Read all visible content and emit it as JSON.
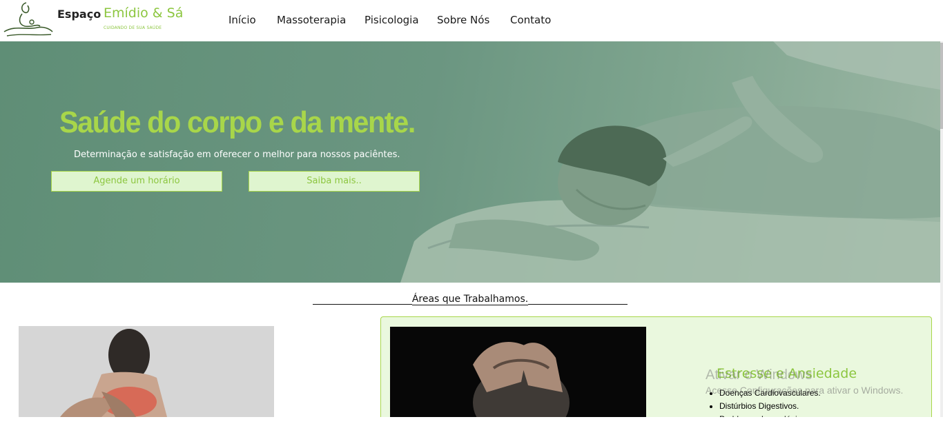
{
  "brand": {
    "name_part1": "Espaço",
    "name_part2": "Emídio & Sá",
    "tagline": "CUIDANDO DE SUA SAÚDE",
    "logo_icon": "massage-figure-icon"
  },
  "nav": {
    "items": [
      {
        "label": "Início"
      },
      {
        "label": "Massoterapia"
      },
      {
        "label": "Pisicologia"
      },
      {
        "label": "Sobre Nós"
      },
      {
        "label": "Contato"
      }
    ]
  },
  "hero": {
    "title": "Saúde do corpo e da mente.",
    "subtitle": "Determinação e satisfação em oferecer o melhor para nossos paciêntes.",
    "primary_button": "Agende um horário",
    "secondary_button": "Saiba mais.."
  },
  "areas": {
    "title": "Áreas que Trabalhamos."
  },
  "card": {
    "title": "Estresse e Ansiedade",
    "items": [
      "Doenças Cardiovasculares.",
      "Distúrbios Digestivos.",
      "Problemas Imunológicos."
    ]
  },
  "watermark": {
    "line1": "Ativar o Windows",
    "line2": "Acesse Configurações para ativar o Windows."
  },
  "colors": {
    "accent": "#8cc63f",
    "hero_overlay": "#6b9681",
    "button_bg": "#dff5cf",
    "card_bg": "#eaf8de"
  }
}
